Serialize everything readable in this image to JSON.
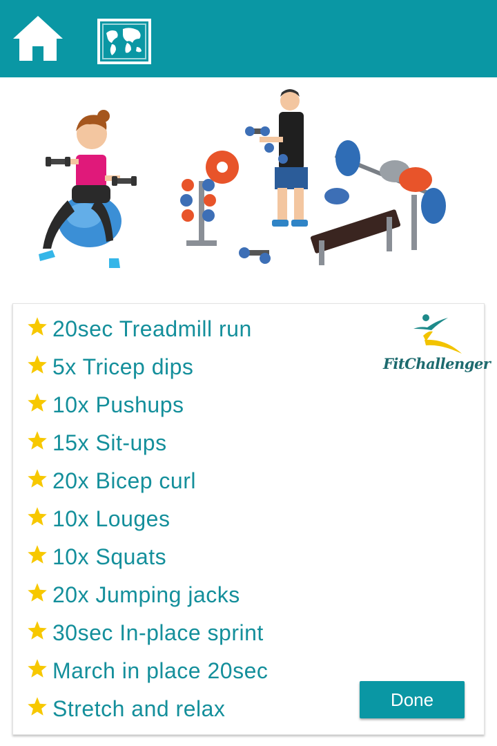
{
  "header": {
    "background_color": "#0a97a4",
    "home_icon": "home-icon",
    "map_icon": "world-map-icon"
  },
  "hero": {
    "illustration": "gym workout illustration"
  },
  "workout": {
    "star_color": "#f7c800",
    "text_color": "#148f9b",
    "items": [
      {
        "label": "20sec Treadmill run"
      },
      {
        "label": "5x Tricep dips"
      },
      {
        "label": "10x Pushups"
      },
      {
        "label": "15x Sit-ups"
      },
      {
        "label": "20x Bicep curl"
      },
      {
        "label": "10x Louges"
      },
      {
        "label": "10x Squats"
      },
      {
        "label": "20x Jumping jacks"
      },
      {
        "label": "30sec In-place sprint"
      },
      {
        "label": "March in place 20sec"
      },
      {
        "label": "Stretch and relax"
      }
    ],
    "logo_text": "FitChallenger",
    "done_label": "Done"
  }
}
